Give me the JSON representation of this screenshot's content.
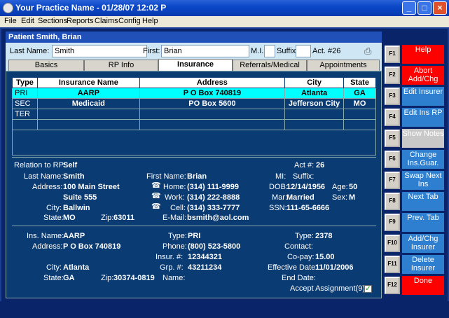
{
  "window": {
    "title": "Your Practice Name  -  01/28/07 12:02 P"
  },
  "menu": [
    "File",
    "Edit",
    "Sections",
    "Reports",
    "Claims",
    "Config",
    "Help"
  ],
  "patient_header": "Patient Smith, Brian",
  "name_strip": {
    "last_label": "Last Name:",
    "last_value": "Smith",
    "first_label": "First:",
    "first_value": "Brian",
    "mi_label": "M.I.",
    "mi_value": "",
    "suffix_label": "Suffix",
    "suffix_value": "",
    "act_label": "Act. #26"
  },
  "tabs": [
    "Basics",
    "RP Info",
    "Insurance",
    "Referrals/Medical",
    "Appointments"
  ],
  "table": {
    "headers": [
      "Type",
      "Insurance Name",
      "Address",
      "City",
      "State"
    ],
    "rows": [
      [
        "PRI",
        "AARP",
        "P O Box 740819",
        "Atlanta",
        "GA"
      ],
      [
        "SEC",
        "Medicaid",
        "PO Box 5600",
        "Jefferson City",
        "MO"
      ],
      [
        "TER",
        "",
        "",
        "",
        ""
      ]
    ]
  },
  "rp": {
    "relation_label": "Relation to RP:",
    "relation": "Self",
    "act_label": "Act #:",
    "act": "26",
    "last_label": "Last Name:",
    "last": "Smith",
    "first_label": "First Name:",
    "first": "Brian",
    "mi_label": "MI:",
    "suffix_label": "Suffix:",
    "address_label": "Address:",
    "address1": "100 Main Street",
    "address2": "Suite 555",
    "city_label": "City:",
    "city": "Ballwin",
    "state_label": "State:",
    "state": "MO",
    "zip_label": "Zip:",
    "zip": "63011",
    "home_label": "Home:",
    "home": "(314) 111-9999",
    "work_label": "Work:",
    "work": "(314) 222-8888",
    "cell_label": "Cell:",
    "cell": "(314) 333-7777",
    "email_label": "E-Mail:",
    "email": "bsmith@aol.com",
    "dob_label": "DOB:",
    "dob": "12/14/1956",
    "age_label": "Age:",
    "age": "50",
    "mar_label": "Mar:",
    "mar": "Married",
    "sex_label": "Sex:",
    "sex": "M",
    "ssn_label": "SSN:",
    "ssn": "111-65-6666"
  },
  "ins": {
    "name_label": "Ins. Name:",
    "name": "AARP",
    "address_label": "Address:",
    "address": "P O Box 740819",
    "city_label": "City:",
    "city": "Atlanta",
    "state_label": "State:",
    "state": "GA",
    "zip_label": "Zip:",
    "zip": "30374-0819",
    "type_label": "Type:",
    "type": "PRI",
    "phone_label": "Phone:",
    "phone": "(800) 523-5800",
    "insur_label": "Insur. #:",
    "insur": "12344321",
    "grp_label": "Grp. #:",
    "grp": "43211234",
    "name2_label": "Name:",
    "type2_label": "Type:",
    "type2": "2378",
    "contact_label": "Contact:",
    "copay_label": "Co-pay:",
    "copay": "15.00",
    "eff_label": "Effective Date:",
    "eff": "11/01/2006",
    "end_label": "End Date:",
    "accept_label": "Accept Assignment(9):"
  },
  "fkeys": [
    {
      "key": "F1",
      "label": "Help",
      "style": "red"
    },
    {
      "key": "F2",
      "label": "Abort Add/Chg",
      "style": "red"
    },
    {
      "key": "F3",
      "label": "Edit Insurer",
      "style": "blue"
    },
    {
      "key": "F4",
      "label": "Edit Ins RP",
      "style": "blue"
    },
    {
      "key": "F5",
      "label": "Show Notes",
      "style": "gray"
    },
    {
      "key": "F6",
      "label": "Change Ins.Guar.",
      "style": "blue"
    },
    {
      "key": "F7",
      "label": "Swap Next Ins",
      "style": "blue"
    },
    {
      "key": "F8",
      "label": "Next Tab",
      "style": "blue"
    },
    {
      "key": "F9",
      "label": "Prev. Tab",
      "style": "blue"
    },
    {
      "key": "F10",
      "label": "Add/Chg Insurer",
      "style": "blue"
    },
    {
      "key": "F11",
      "label": "Delete Insurer",
      "style": "blue"
    },
    {
      "key": "F12",
      "label": "Done",
      "style": "red"
    }
  ]
}
